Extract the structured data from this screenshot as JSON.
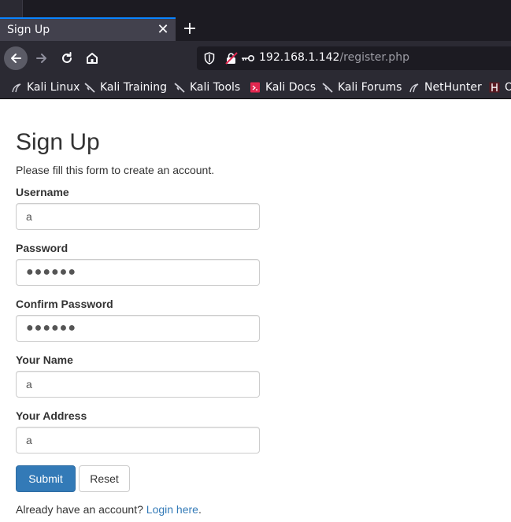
{
  "browser": {
    "tab_title": "Sign Up",
    "close_glyph": "✕",
    "new_tab_glyph": "+",
    "url_host": "192.168.1.142",
    "url_path": "/register.php",
    "bookmarks": [
      {
        "label": "Kali Linux"
      },
      {
        "label": "Kali Training"
      },
      {
        "label": "Kali Tools"
      },
      {
        "label": "Kali Docs"
      },
      {
        "label": "Kali Forums"
      },
      {
        "label": "NetHunter"
      },
      {
        "label": "O"
      }
    ]
  },
  "form": {
    "title": "Sign Up",
    "subtitle": "Please fill this form to create an account.",
    "username_label": "Username",
    "username_value": "a",
    "password_label": "Password",
    "password_value": "●●●●●●",
    "confirm_label": "Confirm Password",
    "confirm_value": "●●●●●●",
    "name_label": "Your Name",
    "name_value": "a",
    "address_label": "Your Address",
    "address_value": "a",
    "submit_label": "Submit",
    "reset_label": "Reset",
    "footer_prefix": "Already have an account?",
    "login_link": "Login here",
    "footer_suffix": "."
  },
  "colors": {
    "accent": "#337ab7",
    "tab_indicator": "#0a84ff",
    "chrome_bg": "#2b2a33"
  }
}
